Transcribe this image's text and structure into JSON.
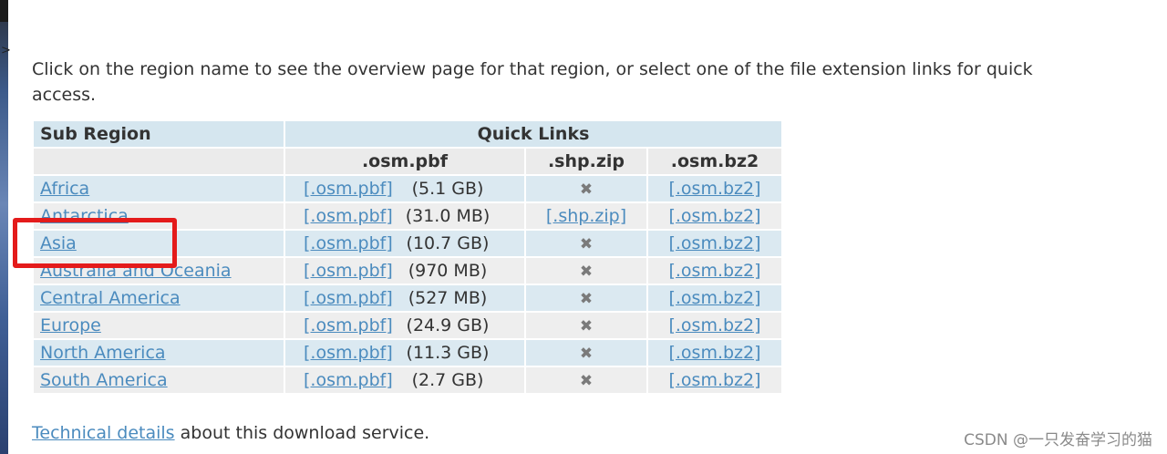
{
  "intro": "Click on the region name to see the overview page for that region, or select one of the file extension links for quick access.",
  "table": {
    "header_sub_region": "Sub Region",
    "header_quick_links": "Quick Links",
    "col_pbf": ".osm.pbf",
    "col_shp": ".shp.zip",
    "col_bz2": ".osm.bz2",
    "rows": [
      {
        "name": "Africa",
        "pbf_link": "[.osm.pbf]",
        "size": "(5.1 GB)",
        "shp": "",
        "bz2": "[.osm.bz2]"
      },
      {
        "name": "Antarctica",
        "pbf_link": "[.osm.pbf]",
        "size": "(31.0 MB)",
        "shp": "[.shp.zip]",
        "bz2": "[.osm.bz2]"
      },
      {
        "name": "Asia",
        "pbf_link": "[.osm.pbf]",
        "size": "(10.7 GB)",
        "shp": "",
        "bz2": "[.osm.bz2]"
      },
      {
        "name": "Australia and Oceania",
        "pbf_link": "[.osm.pbf]",
        "size": "(970 MB)",
        "shp": "",
        "bz2": "[.osm.bz2]"
      },
      {
        "name": "Central America",
        "pbf_link": "[.osm.pbf]",
        "size": "(527 MB)",
        "shp": "",
        "bz2": "[.osm.bz2]"
      },
      {
        "name": "Europe",
        "pbf_link": "[.osm.pbf]",
        "size": "(24.9 GB)",
        "shp": "",
        "bz2": "[.osm.bz2]"
      },
      {
        "name": "North America",
        "pbf_link": "[.osm.pbf]",
        "size": "(11.3 GB)",
        "shp": "",
        "bz2": "[.osm.bz2]"
      },
      {
        "name": "South America",
        "pbf_link": "[.osm.pbf]",
        "size": "(2.7 GB)",
        "shp": "",
        "bz2": "[.osm.bz2]"
      }
    ],
    "unavailable_mark": "✖"
  },
  "footer": {
    "link": "Technical details",
    "text": " about this download service."
  },
  "watermark": "CSDN @一只发奋学习的猫",
  "colors": {
    "link": "#4b8bbe",
    "header_bg": "#d5e6ef",
    "row_odd_bg": "#dbe9f1",
    "row_even_bg": "#eeeeee",
    "highlight_box": "#e41b1b"
  }
}
